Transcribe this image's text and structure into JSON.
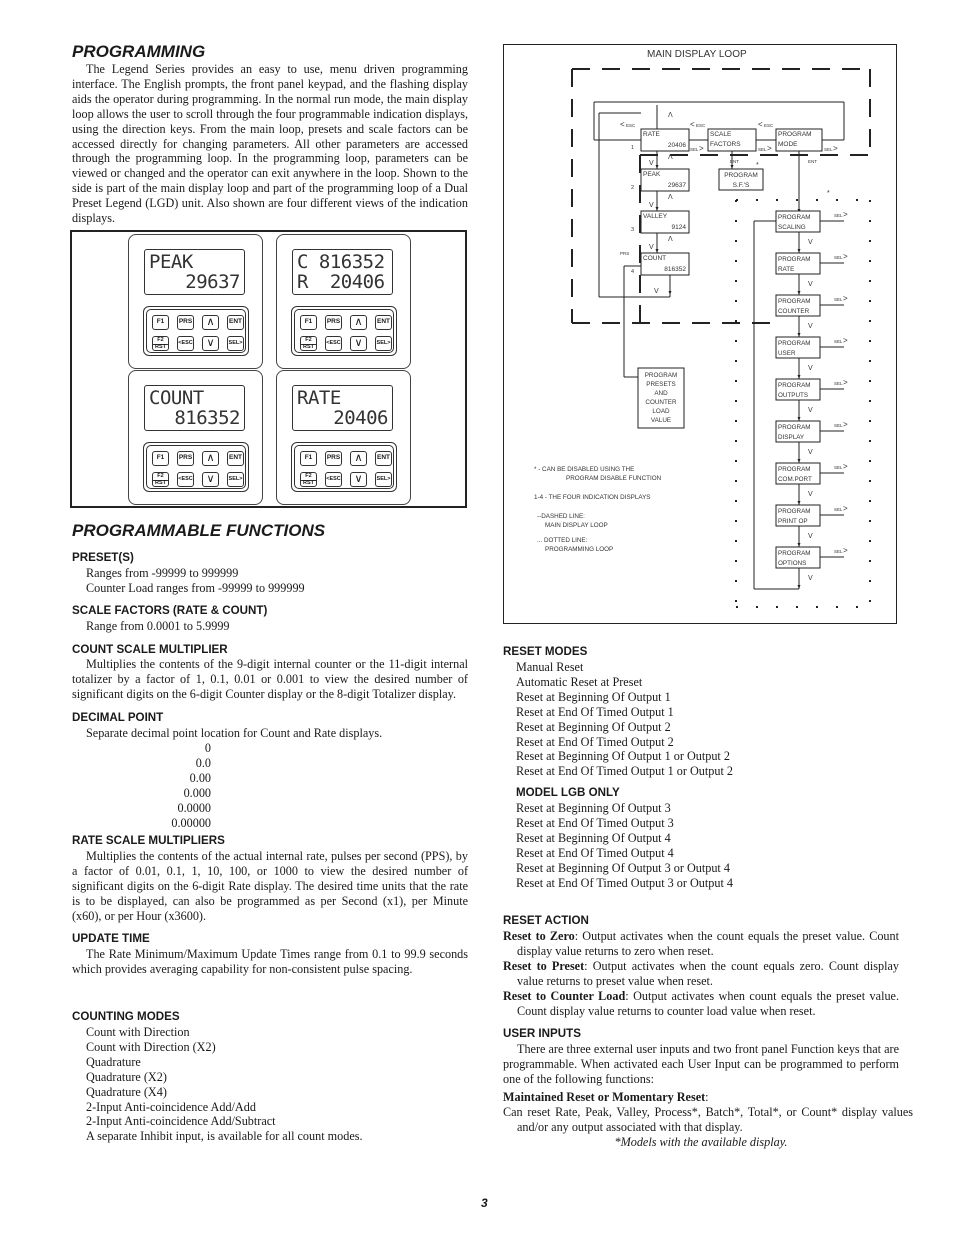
{
  "left": {
    "programming": {
      "title": "PROGRAMMING",
      "body": "The Legend Series provides an easy to use, menu driven programming interface. The English prompts, the front panel keypad, and the flashing display aids the operator during programming. In the normal run mode, the main display loop allows the user to scroll through the four programmable indication displays, using the direction keys. From the main loop, presets and scale factors can be accessed directly for changing parameters. All other parameters are accessed through the programming loop. In the programming loop, parameters can be viewed or changed and the operator can exit anywhere in the loop. Shown to the side is part of the main display loop and part of the programming loop of a Dual Preset Legend (LGD) unit. Also shown are four different views of the indication displays."
    },
    "displays": [
      {
        "line1": "PEAK",
        "line2": "29637"
      },
      {
        "line1": "C 816352",
        "line2": "R  20406"
      },
      {
        "line1": "COUNT",
        "line2": "816352"
      },
      {
        "line1": "RATE",
        "line2": "20406"
      }
    ],
    "keys": {
      "f1": "F1",
      "prs": "PRS",
      "ent": "ENT",
      "f2": "F2",
      "rst": "RST",
      "esc": "ESC",
      "sel": "SEL"
    },
    "functions_title": "PROGRAMMABLE FUNCTIONS",
    "presets": {
      "title": "PRESET(S)",
      "lines": [
        "Ranges from -99999 to 999999",
        "Counter Load ranges from -99999 to 999999"
      ]
    },
    "scale_factors": {
      "title": "SCALE FACTORS (RATE & COUNT)",
      "lines": [
        "Range from 0.0001 to 5.9999"
      ]
    },
    "count_scale": {
      "title": "COUNT SCALE MULTIPLIER",
      "body": "Multiplies the contents of the 9-digit internal counter or the 11-digit internal totalizer by a factor of 1, 0.1, 0.01 or 0.001 to view the desired number of significant digits on the 6-digit Counter display or the 8-digit Totalizer display."
    },
    "decimal_point": {
      "title": "DECIMAL POINT",
      "body": "Separate decimal point location for Count and Rate displays.",
      "values": [
        "0",
        "0.0",
        "0.00",
        "0.000",
        "0.0000",
        "0.00000"
      ]
    },
    "rate_scale": {
      "title": "RATE SCALE MULTIPLIERS",
      "body": "Multiplies the contents of the actual internal rate, pulses per second (PPS), by a factor of 0.01, 0.1, 1, 10, 100, or 1000 to view the desired number of significant digits on the 6-digit Rate display. The desired time units that the rate is to be displayed, can also be programmed as per Second (x1), per Minute (x60), or per Hour (x3600)."
    },
    "update_time": {
      "title": "UPDATE TIME",
      "body": "The Rate Minimum/Maximum Update Times range from 0.1 to 99.9 seconds which provides averaging capability for non-consistent pulse spacing."
    },
    "counting_modes": {
      "title": "COUNTING MODES",
      "lines": [
        "Count with Direction",
        "Count with Direction (X2)",
        "Quadrature",
        "Quadrature (X2)",
        "Quadrature (X4)",
        "2-Input Anti-coincidence Add/Add",
        "2-Input Anti-coincidence Add/Subtract",
        "A separate Inhibit input, is available for all count modes."
      ]
    }
  },
  "diagram": {
    "title": "MAIN DISPLAY LOOP",
    "main_boxes": [
      {
        "line1": "RATE",
        "line2": "20406",
        "index": "1"
      },
      {
        "line1": "PEAK",
        "line2": "29637",
        "index": "2"
      },
      {
        "line1": "VALLEY",
        "line2": "9124",
        "index": "3"
      },
      {
        "line1": "COUNT",
        "line2": "816352",
        "index": "4"
      }
    ],
    "scale_factors": [
      "SCALE",
      "FACTORS"
    ],
    "program_mode": [
      "PROGRAM",
      "MODE"
    ],
    "program_sfs": [
      "PROGRAM",
      "S.F.'S"
    ],
    "program_presets": [
      "PROGRAM",
      "PRESETS",
      "AND",
      "COUNTER",
      "LOAD",
      "VALUE"
    ],
    "program_loop": [
      [
        "PROGRAM",
        "SCALING"
      ],
      [
        "PROGRAM",
        "RATE"
      ],
      [
        "PROGRAM",
        "COUNTER"
      ],
      [
        "PROGRAM",
        "USER"
      ],
      [
        "PROGRAM",
        "OUTPUTS"
      ],
      [
        "PROGRAM",
        "DISPLAY"
      ],
      [
        "PROGRAM",
        "COM.PORT"
      ],
      [
        "PROGRAM",
        "PRINT OP"
      ],
      [
        "PROGRAM",
        "OPTIONS"
      ]
    ],
    "labels": {
      "esc": "ESC",
      "sel": "SEL",
      "ent": "ENT",
      "prs": "PRS",
      "up": "Λ",
      "down": "V",
      "star": "*",
      "lt": "<",
      "gt": ">"
    },
    "legend": [
      "*   - CAN BE DISABLED USING THE",
      "PROGRAM DISABLE FUNCTION",
      "1-4 - THE FOUR INDICATION DISPLAYS",
      "--DASHED LINE:",
      "MAIN DISPLAY LOOP",
      "... DOTTED LINE:",
      "PROGRAMMING LOOP"
    ]
  },
  "right": {
    "reset_modes": {
      "title": "RESET MODES",
      "lines": [
        "Manual Reset",
        "Automatic Reset at Preset",
        "Reset at Beginning Of Output 1",
        "Reset at End Of Timed Output 1",
        "Reset at Beginning Of Output 2",
        "Reset at End Of Timed Output 2",
        "Reset at Beginning Of Output 1 or Output 2",
        "Reset at End Of Timed Output 1 or Output 2"
      ]
    },
    "model_lgb": {
      "title": "MODEL LGB ONLY",
      "lines": [
        "Reset at Beginning Of Output 3",
        "Reset at End Of Timed Output 3",
        "Reset at Beginning Of Output 4",
        "Reset at End Of Timed Output 4",
        "Reset at Beginning Of Output 3 or Output 4",
        "Reset at End Of Timed Output 3 or Output 4"
      ]
    },
    "reset_action": {
      "title": "RESET ACTION",
      "items": [
        {
          "term": "Reset to Zero",
          "text": ": Output activates when the count equals the preset value. Count display value returns to zero when reset."
        },
        {
          "term": "Reset to Preset",
          "text": ": Output activates when the count equals zero. Count display value returns to preset value when reset."
        },
        {
          "term": "Reset to Counter Load",
          "text": ": Output activates when count equals the preset value. Count display value returns to counter load value when reset."
        }
      ]
    },
    "user_inputs": {
      "title": "USER INPUTS",
      "body": "There are three external user inputs and two front panel Function keys that are programmable. When activated each User Input can be programmed to perform one of the following functions:",
      "sub_term": "Maintained Reset or Momentary Reset",
      "sub_colon": ":",
      "sub_text": "Can reset Rate, Peak, Valley, Process*, Batch*, Total*, or Count* display values and/or any output associated with that display.",
      "footnote": "*Models with the available display."
    }
  },
  "page_number": "3"
}
